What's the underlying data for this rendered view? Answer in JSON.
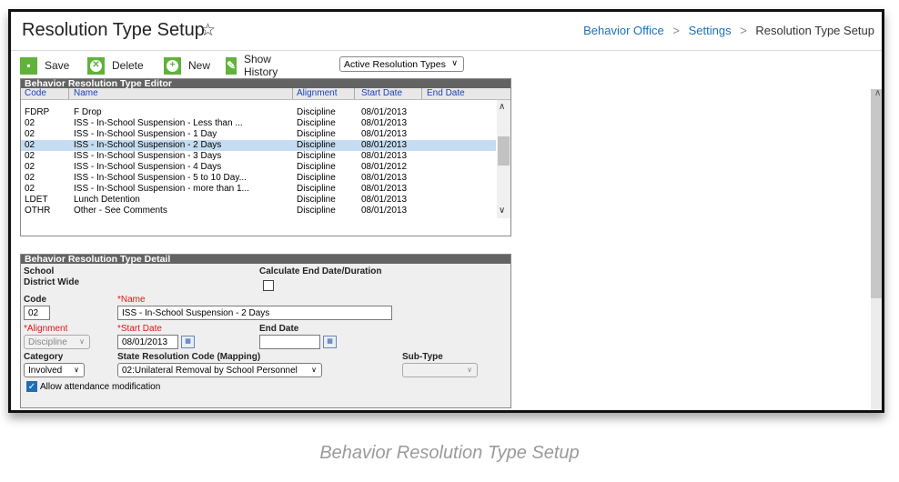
{
  "header": {
    "title": "Resolution Type Setup"
  },
  "breadcrumb": {
    "items": [
      "Behavior Office",
      "Settings"
    ],
    "current": "Resolution Type Setup"
  },
  "toolbar": {
    "save": "Save",
    "delete": "Delete",
    "new": "New",
    "show_history": "Show History",
    "filter_selected": "Active Resolution Types"
  },
  "editor": {
    "title": "Behavior Resolution Type Editor",
    "columns": [
      "Code",
      "Name",
      "Alignment",
      "Start Date",
      "End Date"
    ],
    "rows": [
      {
        "code": "FDRP",
        "name": "F Drop",
        "alignment": "Discipline",
        "start": "08/01/2013",
        "end": ""
      },
      {
        "code": "02",
        "name": "ISS - In-School Suspension - Less than ...",
        "alignment": "Discipline",
        "start": "08/01/2013",
        "end": ""
      },
      {
        "code": "02",
        "name": "ISS - In-School Suspension - 1 Day",
        "alignment": "Discipline",
        "start": "08/01/2013",
        "end": ""
      },
      {
        "code": "02",
        "name": "ISS - In-School Suspension - 2 Days",
        "alignment": "Discipline",
        "start": "08/01/2013",
        "end": ""
      },
      {
        "code": "02",
        "name": "ISS - In-School Suspension - 3 Days",
        "alignment": "Discipline",
        "start": "08/01/2013",
        "end": ""
      },
      {
        "code": "02",
        "name": "ISS - In-School Suspension - 4 Days",
        "alignment": "Discipline",
        "start": "08/01/2012",
        "end": ""
      },
      {
        "code": "02",
        "name": "ISS - In-School Suspension - 5 to 10 Day...",
        "alignment": "Discipline",
        "start": "08/01/2013",
        "end": ""
      },
      {
        "code": "02",
        "name": "ISS - In-School Suspension - more than 1...",
        "alignment": "Discipline",
        "start": "08/01/2013",
        "end": ""
      },
      {
        "code": "LDET",
        "name": "Lunch Detention",
        "alignment": "Discipline",
        "start": "08/01/2013",
        "end": ""
      },
      {
        "code": "OTHR",
        "name": "Other - See Comments",
        "alignment": "Discipline",
        "start": "08/01/2013",
        "end": ""
      }
    ]
  },
  "detail": {
    "title": "Behavior Resolution Type Detail",
    "school_label": "School",
    "school_value": "District Wide",
    "calc_label": "Calculate End Date/Duration",
    "code_label": "Code",
    "code_value": "02",
    "name_label": "*Name",
    "name_value": "ISS - In-School Suspension - 2 Days",
    "alignment_label": "*Alignment",
    "alignment_value": "Discipline",
    "start_label": "*Start Date",
    "start_value": "08/01/2013",
    "end_label": "End Date",
    "end_value": "",
    "category_label": "Category",
    "category_value": "Involved",
    "state_label": "State Resolution Code (Mapping)",
    "state_value": "02:Unilateral Removal by School Personnel",
    "subtype_label": "Sub-Type",
    "subtype_value": "",
    "allow_label": "Allow attendance modification"
  },
  "caption": "Behavior Resolution Type Setup"
}
